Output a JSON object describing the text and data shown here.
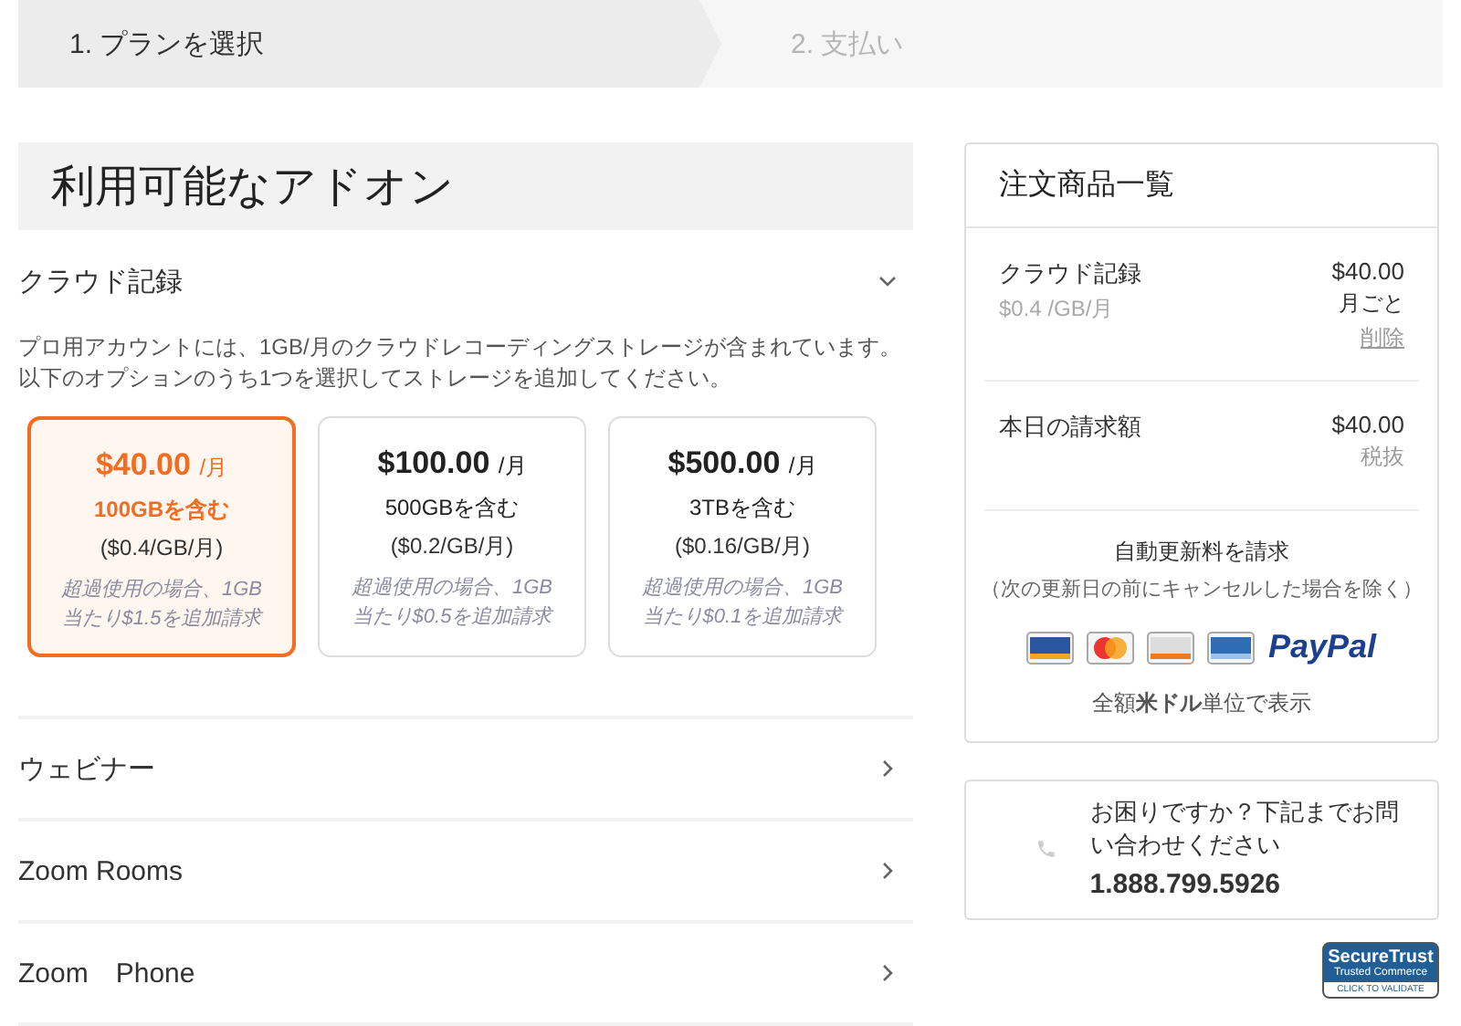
{
  "steps": [
    {
      "label": "1. プランを選択",
      "selected": true
    },
    {
      "label": "2. 支払い",
      "selected": false
    }
  ],
  "heading": "利用可能なアドオン",
  "sections": [
    {
      "title": "クラウド記録",
      "expanded": true,
      "description": "プロ用アカウントには、1GB/月のクラウドレコーディングストレージが含まれています。以下のオプションのうち1つを選択してストレージを追加してください。",
      "plans": [
        {
          "price": "$40.00",
          "unit": "/月",
          "storage": "100GBを含む",
          "per_gb": "($0.4/GB/月)",
          "note": "超過使用の場合、1GB当たり$1.5を追加請求",
          "selected": true
        },
        {
          "price": "$100.00",
          "unit": "/月",
          "storage": "500GBを含む",
          "per_gb": "($0.2/GB/月)",
          "note": "超過使用の場合、1GB当たり$0.5を追加請求",
          "selected": false
        },
        {
          "price": "$500.00",
          "unit": "/月",
          "storage": "3TBを含む",
          "per_gb": "($0.16/GB/月)",
          "note": "超過使用の場合、1GB当たり$0.1を追加請求",
          "selected": false
        }
      ]
    },
    {
      "title": "ウェビナー",
      "expanded": false
    },
    {
      "title": "Zoom Rooms",
      "expanded": false
    },
    {
      "title": "Zoom　Phone",
      "expanded": false
    }
  ],
  "order": {
    "title": "注文商品一覧",
    "item": {
      "name": "クラウド記録",
      "rate": "$0.4 /GB/月",
      "price": "$40.00",
      "period": "月ごと",
      "remove": "削除"
    },
    "total": {
      "label": "本日の請求額",
      "amount": "$40.00",
      "tax": "税抜"
    },
    "renewal": "自動更新料を請求",
    "renewal_note": "（次の更新日の前にキャンセルした場合を除く）",
    "payment_logos": [
      {
        "kind": "visa"
      },
      {
        "kind": "mastercard"
      },
      {
        "kind": "discover"
      },
      {
        "kind": "amex"
      },
      {
        "kind": "paypal",
        "text": "PayPal"
      }
    ],
    "currency_note": "全額**米ドル**単位で表示"
  },
  "support": {
    "text": "お困りですか？下記までお問い合わせください",
    "phone": "1.888.799.5926"
  },
  "trust_badge": {
    "title": "SecureTrust",
    "subtitle": "Trusted Commerce",
    "action": "CLICK TO VALIDATE"
  }
}
